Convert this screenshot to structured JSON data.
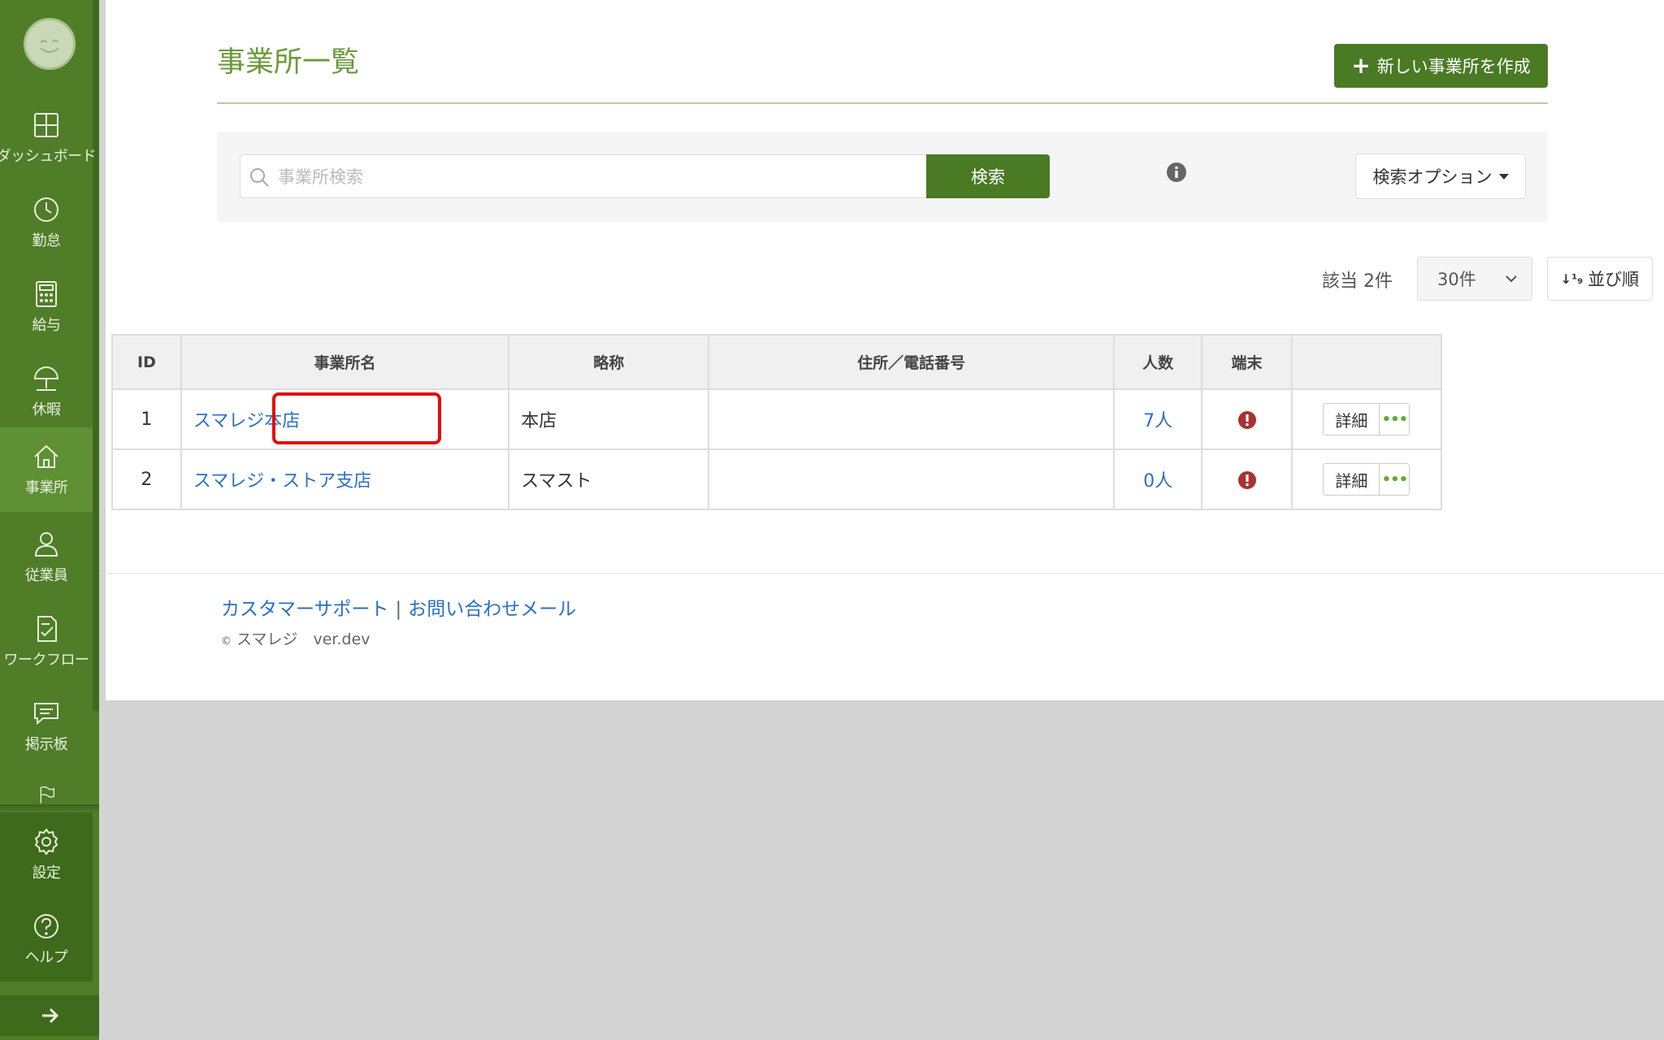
{
  "sidebar": {
    "items": [
      {
        "label": "ダッシュボード",
        "icon": "dashboard-icon"
      },
      {
        "label": "勤怠",
        "icon": "clock-icon"
      },
      {
        "label": "給与",
        "icon": "calculator-icon"
      },
      {
        "label": "休暇",
        "icon": "umbrella-icon"
      },
      {
        "label": "事業所",
        "icon": "home-icon"
      },
      {
        "label": "従業員",
        "icon": "user-icon"
      },
      {
        "label": "ワークフロー",
        "icon": "checklist-icon"
      },
      {
        "label": "掲示板",
        "icon": "chat-icon"
      }
    ],
    "bottom": [
      {
        "label": "設定",
        "icon": "gear-icon"
      },
      {
        "label": "ヘルプ",
        "icon": "help-icon"
      }
    ]
  },
  "header": {
    "title": "事業所一覧",
    "create_label": "新しい事業所を作成"
  },
  "search": {
    "placeholder": "事業所検索",
    "value": "",
    "button_label": "検索",
    "options_label": "検索オプション"
  },
  "results": {
    "count_label": "該当 2件",
    "per_page": "30件",
    "sort_label": "並び順"
  },
  "table": {
    "columns": [
      "ID",
      "事業所名",
      "略称",
      "住所／電話番号",
      "人数",
      "端末",
      ""
    ],
    "rows": [
      {
        "id": "1",
        "name": "スマレジ本店",
        "abbr": "本店",
        "address": "",
        "people": "7人",
        "detail": "詳細",
        "more": "•••"
      },
      {
        "id": "2",
        "name": "スマレジ・ストア支店",
        "abbr": "スマスト",
        "address": "",
        "people": "0人",
        "detail": "詳細",
        "more": "•••"
      }
    ]
  },
  "footer": {
    "support_link": "カスタマーサポート",
    "separator": "|",
    "mail_link": "お問い合わせメール",
    "copyright_symbol": "©",
    "copyright": "スマレジ　ver.dev"
  },
  "colors": {
    "sidebar": "#4f7d28",
    "accent": "#4a7a24",
    "title": "#6b9a3a",
    "link": "#2a6fc6",
    "alert": "#a83232",
    "highlight": "#e30d0d"
  }
}
